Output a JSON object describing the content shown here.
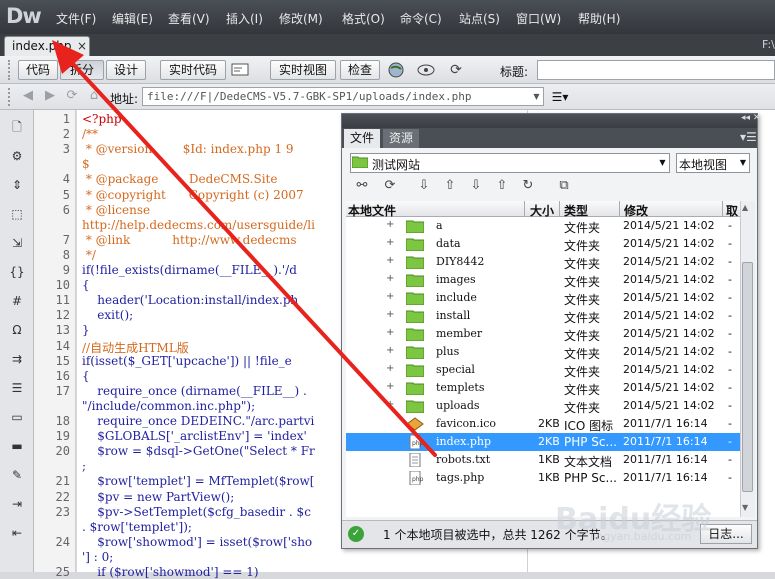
{
  "app": {
    "logo": "Dw",
    "menu": [
      "文件(F)",
      "编辑(E)",
      "查看(V)",
      "插入(I)",
      "修改(M)",
      "格式(O)",
      "命令(C)",
      "站点(S)",
      "窗口(W)",
      "帮助(H)"
    ],
    "window_path": "F:\\"
  },
  "document_tab": {
    "label": "index.php",
    "close": "×"
  },
  "toolbar": {
    "code_label": "代码",
    "split_label": "拆分",
    "design_label": "设计",
    "live_code_label": "实时代码",
    "live_view_label": "实时视图",
    "inspect_label": "检查",
    "title_label": "标题:"
  },
  "address": {
    "label": "地址:",
    "value": "file:///F|/DedeCMS-V5.7-GBK-SP1/uploads/index.php"
  },
  "gutter_icons": [
    "file-icon",
    "gear-icon",
    "expand-icon",
    "select-icon",
    "collapse-icon",
    "braces-icon",
    "hash-icon",
    "omega-icon",
    "wrap-icon",
    "format-icon",
    "comment-icon",
    "uncomment-icon",
    "brush-icon",
    "indent-icon",
    "outdent-icon"
  ],
  "code": {
    "line_numbers": [
      "1",
      "2",
      "3",
      "",
      "4",
      "5",
      "6",
      "",
      "7",
      "8",
      "9",
      "10",
      "11",
      "12",
      "13",
      "14",
      "15",
      "16",
      "17",
      "",
      "18",
      "19",
      "20",
      "",
      "21",
      "22",
      "23",
      "",
      "24",
      "",
      "25"
    ],
    "lines": [
      "<?php",
      "/**",
      " * @version        $Id: index.php 1 9",
      "$",
      " * @package        DedeCMS.Site",
      " * @copyright      Copyright (c) 2007",
      " * @license",
      "http://help.dedecms.com/usersguide/li",
      " * @link           http://www.dedecms",
      " */",
      "if(!file_exists(dirname(__FILE__).'/d",
      "{",
      "    header('Location:install/index.ph",
      "    exit();",
      "}",
      "//自动生成HTML版",
      "if(isset($_GET['upcache']) || !file_e",
      "{",
      "    require_once (dirname(__FILE__) .",
      "\"/include/common.inc.php\");",
      "    require_once DEDEINC.\"/arc.partvi",
      "    $GLOBALS['_arclistEnv'] = 'index'",
      "    $row = $dsql->GetOne(\"Select * Fr",
      ";",
      "    $row['templet'] = MfTemplet($row[",
      "    $pv = new PartView();",
      "    $pv->SetTemplet($cfg_basedir . $c",
      ". $row['templet']);",
      "    $row['showmod'] = isset($row['sho",
      "'] : 0;",
      "    if ($row['showmod'] == 1)"
    ]
  },
  "files_panel": {
    "tab_files": "文件",
    "tab_assets": "资源",
    "site": "测试网站",
    "view": "本地视图",
    "columns": {
      "name": "本地文件",
      "size": "大小",
      "type": "类型",
      "modified": "修改",
      "extra": "取"
    },
    "rows": [
      {
        "expander": "+",
        "icon": "folder",
        "name": "a",
        "size": "",
        "type": "文件夹",
        "modified": "2014/5/21 14:02",
        "extra": "-",
        "selected": false
      },
      {
        "expander": "+",
        "icon": "folder",
        "name": "data",
        "size": "",
        "type": "文件夹",
        "modified": "2014/5/21 14:02",
        "extra": "-",
        "selected": false
      },
      {
        "expander": "+",
        "icon": "folder",
        "name": "DIY8442",
        "size": "",
        "type": "文件夹",
        "modified": "2014/5/21 14:02",
        "extra": "-",
        "selected": false
      },
      {
        "expander": "+",
        "icon": "folder",
        "name": "images",
        "size": "",
        "type": "文件夹",
        "modified": "2014/5/21 14:02",
        "extra": "-",
        "selected": false
      },
      {
        "expander": "+",
        "icon": "folder",
        "name": "include",
        "size": "",
        "type": "文件夹",
        "modified": "2014/5/21 14:02",
        "extra": "-",
        "selected": false
      },
      {
        "expander": "+",
        "icon": "folder",
        "name": "install",
        "size": "",
        "type": "文件夹",
        "modified": "2014/5/21 14:02",
        "extra": "-",
        "selected": false
      },
      {
        "expander": "+",
        "icon": "folder",
        "name": "member",
        "size": "",
        "type": "文件夹",
        "modified": "2014/5/21 14:02",
        "extra": "-",
        "selected": false
      },
      {
        "expander": "+",
        "icon": "folder",
        "name": "plus",
        "size": "",
        "type": "文件夹",
        "modified": "2014/5/21 14:02",
        "extra": "-",
        "selected": false
      },
      {
        "expander": "+",
        "icon": "folder",
        "name": "special",
        "size": "",
        "type": "文件夹",
        "modified": "2014/5/21 14:02",
        "extra": "-",
        "selected": false
      },
      {
        "expander": "+",
        "icon": "folder",
        "name": "templets",
        "size": "",
        "type": "文件夹",
        "modified": "2014/5/21 14:02",
        "extra": "-",
        "selected": false
      },
      {
        "expander": "+",
        "icon": "folder",
        "name": "uploads",
        "size": "",
        "type": "文件夹",
        "modified": "2014/5/21 14:02",
        "extra": "-",
        "selected": false
      },
      {
        "expander": "",
        "icon": "ico",
        "name": "favicon.ico",
        "size": "2KB",
        "type": "ICO 图标",
        "modified": "2011/7/1 16:14",
        "extra": "-",
        "selected": false
      },
      {
        "expander": "",
        "icon": "php",
        "name": "index.php",
        "size": "2KB",
        "type": "PHP Sc...",
        "modified": "2011/7/1 16:14",
        "extra": "-",
        "selected": true
      },
      {
        "expander": "",
        "icon": "txt",
        "name": "robots.txt",
        "size": "1KB",
        "type": "文本文档",
        "modified": "2011/7/1 16:14",
        "extra": "-",
        "selected": false
      },
      {
        "expander": "",
        "icon": "php",
        "name": "tags.php",
        "size": "1KB",
        "type": "PHP Sc...",
        "modified": "2011/7/1 16:14",
        "extra": "-",
        "selected": false
      }
    ],
    "status": "1 个本地项目被选中，总共 1262 个字节。",
    "log_button": "日志..."
  },
  "watermark": {
    "main": "Baidu经验",
    "sub": "jingyan.baidu.com"
  },
  "colors": {
    "selection": "#3399ff",
    "arrow": "#e8221c",
    "folder": "#7cc642",
    "comment": "#d4691e",
    "code": "#1f1fa0"
  }
}
